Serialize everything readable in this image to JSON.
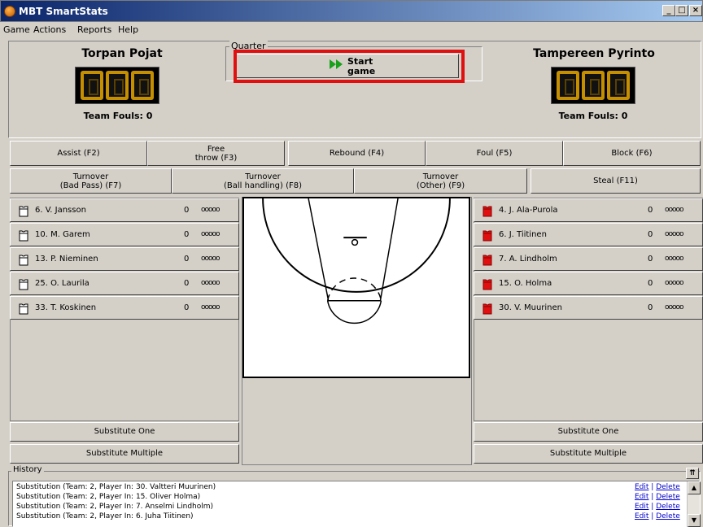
{
  "window": {
    "title": "MBT SmartStats",
    "minimize": "_",
    "maximize": "□",
    "close": "×"
  },
  "menu": [
    "Game",
    "Actions",
    "Reports",
    "Help"
  ],
  "home": {
    "name": "Torpan Pojat",
    "score": "000",
    "fouls": "Team Fouls: 0"
  },
  "away": {
    "name": "Tampereen Pyrinto",
    "score": "000",
    "fouls": "Team Fouls: 0"
  },
  "quarter": {
    "label": "Quarter",
    "start_line1": "Start",
    "start_line2": "game"
  },
  "actions_row1": [
    {
      "label": "Assist (F2)"
    },
    {
      "label": "Free\nthrow (F3)"
    },
    {
      "label": "Rebound (F4)"
    },
    {
      "label": "Foul (F5)"
    },
    {
      "label": "Block (F6)"
    }
  ],
  "actions_row2": [
    {
      "label": "Turnover\n(Bad Pass) (F7)"
    },
    {
      "label": "Turnover\n(Ball handling) (F8)"
    },
    {
      "label": "Turnover\n(Other) (F9)"
    },
    {
      "label": "Steal (F11)"
    }
  ],
  "home_players": [
    {
      "name": "6. V. Jansson",
      "points": "0",
      "fouls": "ooooo"
    },
    {
      "name": "10. M. Garem",
      "points": "0",
      "fouls": "ooooo"
    },
    {
      "name": "13. P. Nieminen",
      "points": "0",
      "fouls": "ooooo"
    },
    {
      "name": "25. O. Laurila",
      "points": "0",
      "fouls": "ooooo"
    },
    {
      "name": "33. T. Koskinen",
      "points": "0",
      "fouls": "ooooo"
    }
  ],
  "away_players": [
    {
      "name": "4. J. Ala-Purola",
      "points": "0",
      "fouls": "ooooo"
    },
    {
      "name": "6. J. Tiitinen",
      "points": "0",
      "fouls": "ooooo"
    },
    {
      "name": "7. A. Lindholm",
      "points": "0",
      "fouls": "ooooo"
    },
    {
      "name": "15. O. Holma",
      "points": "0",
      "fouls": "ooooo"
    },
    {
      "name": "30. V. Muurinen",
      "points": "0",
      "fouls": "ooooo"
    }
  ],
  "substitute": {
    "one": "Substitute One",
    "multiple": "Substitute Multiple"
  },
  "history": {
    "label": "History",
    "entries": [
      {
        "text": "Substitution (Team: 2, Player In: 30. Valtteri Muurinen)",
        "edit": "Edit",
        "sep": " | ",
        "delete": "Delete"
      },
      {
        "text": "Substitution (Team: 2, Player In: 15. Oliver Holma)",
        "edit": "Edit",
        "sep": " | ",
        "delete": "Delete"
      },
      {
        "text": "Substitution (Team: 2, Player In: 7. Anselmi Lindholm)",
        "edit": "Edit",
        "sep": " | ",
        "delete": "Delete"
      },
      {
        "text": "Substitution (Team: 2, Player In: 6. Juha Tiitinen)",
        "edit": "Edit",
        "sep": " | ",
        "delete": "Delete"
      }
    ]
  },
  "colors": {
    "home_jersey": "#ffffff",
    "away_jersey": "#e01010",
    "highlight": "#e01010",
    "digit": "#c58f00"
  }
}
